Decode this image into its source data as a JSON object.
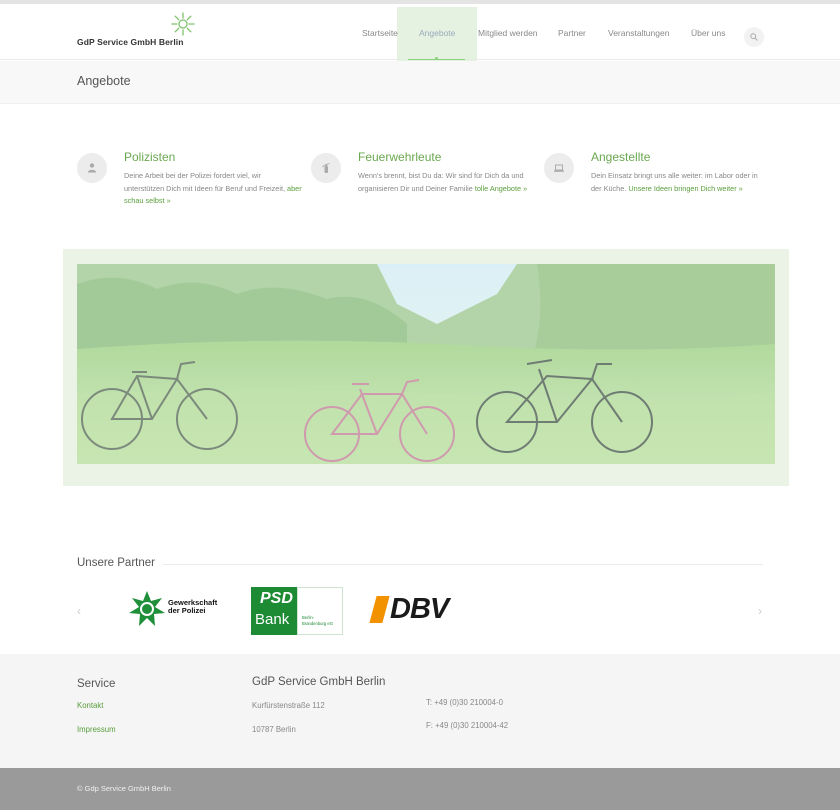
{
  "brand": {
    "name": "GdP Service GmbH Berlin",
    "accent": "#6aa84f"
  },
  "nav": {
    "items": [
      {
        "label": "Startseite",
        "active": false
      },
      {
        "label": "Angebote",
        "active": true
      },
      {
        "label": "Mitglied werden",
        "active": false
      },
      {
        "label": "Partner",
        "active": false
      },
      {
        "label": "Veranstaltungen",
        "active": false
      },
      {
        "label": "Über uns",
        "active": false
      }
    ],
    "search_icon": "search-icon"
  },
  "page": {
    "title": "Angebote"
  },
  "features": [
    {
      "icon": "user-icon",
      "title": "Polizisten",
      "text": "Deine Arbeit bei der Polizei fordert viel, wir unterstützen Dich mit Ideen für Beruf und Freizeit, ",
      "link": "aber schau selbst »"
    },
    {
      "icon": "fire-extinguisher-icon",
      "title": "Feuerwehrleute",
      "text": "Wenn's brennt, bist Du da: Wir sind für Dich da und organisieren Dir und Deiner Familie ",
      "link": "tolle Angebote »"
    },
    {
      "icon": "laptop-icon",
      "title": "Angestellte",
      "text": "Dein Einsatz bringt uns alle weiter: im Labor oder in der Küche. ",
      "link": "Unsere Ideen bringen Dich weiter »"
    }
  ],
  "partners": {
    "title": "Unsere Partner",
    "prev": "‹",
    "next": "›",
    "logos": [
      {
        "name": "Gewerkschaft der Polizei",
        "line1": "Gewerkschaft",
        "line2": "der Polizei"
      },
      {
        "name": "PSD Bank Berlin-Brandenburg eG",
        "word1": "PSD",
        "word2": "Bank",
        "sub1": "Berlin-",
        "sub2": "Brandenburg eG"
      },
      {
        "name": "DBV",
        "word": "DBV"
      }
    ]
  },
  "footer": {
    "service": {
      "title": "Service",
      "links": [
        "Kontakt",
        "Impressum"
      ]
    },
    "company": {
      "title": "GdP Service GmbH Berlin",
      "street": "Kurfürstenstraße 112",
      "city": "10787 Berlin",
      "phone": "T: +49 (0)30 210004-0",
      "fax": "F: +49 (0)30 210004-42"
    },
    "copyright": "© Gdp Service GmbH Berlin"
  }
}
